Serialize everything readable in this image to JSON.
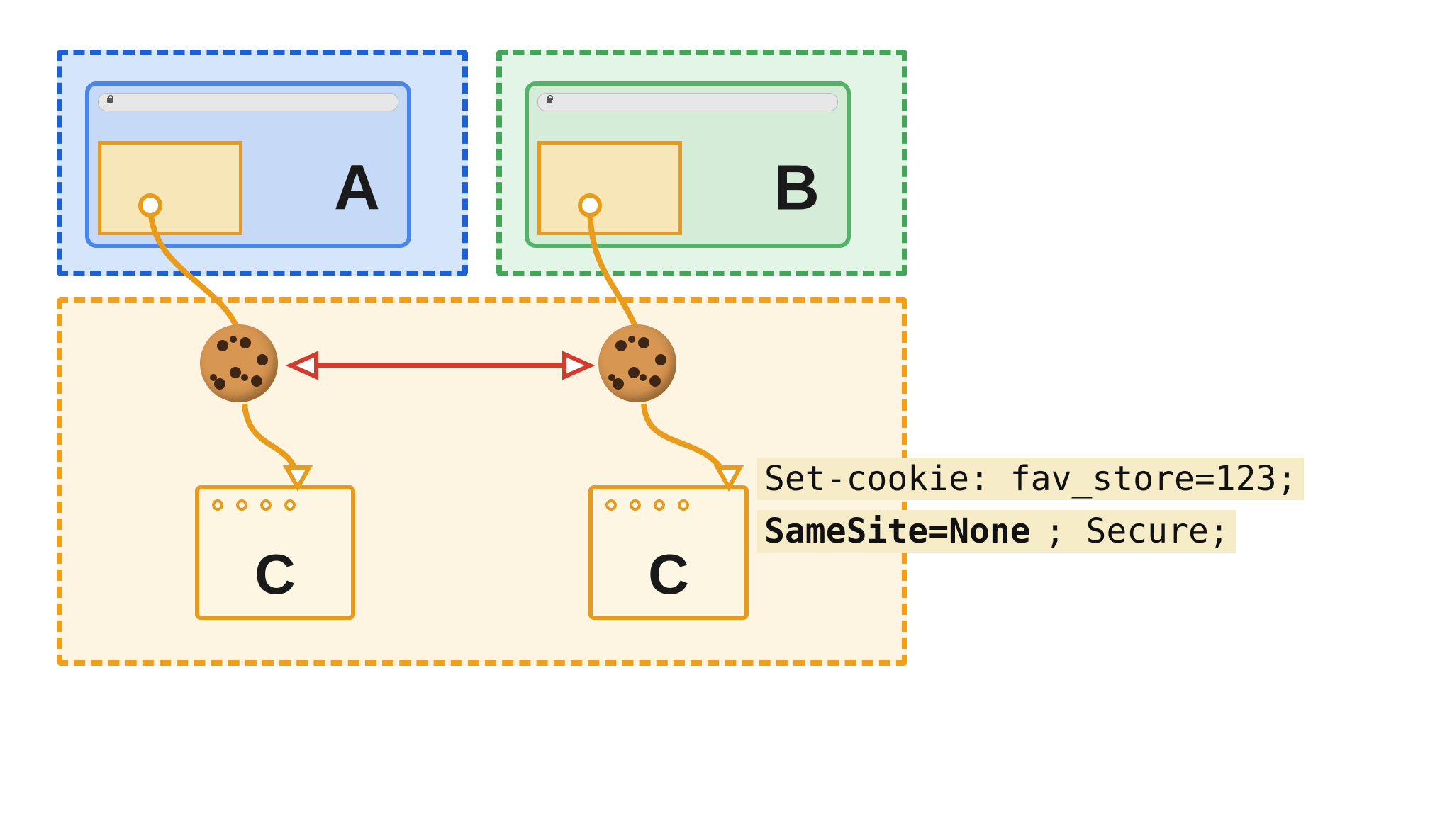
{
  "regions": {
    "blue": {
      "label": "A",
      "color": "#1f5fcf"
    },
    "green": {
      "label": "B",
      "color": "#46a35a"
    },
    "orange": {
      "label": "C",
      "color": "#ef9f1b"
    }
  },
  "browsers": {
    "blue": {
      "label": "A"
    },
    "green": {
      "label": "B"
    }
  },
  "c_windows": {
    "left": {
      "label": "C"
    },
    "right": {
      "label": "C"
    }
  },
  "cookies": [
    "cookie1",
    "cookie2"
  ],
  "code_callout": {
    "line1_full": "Set-cookie: fav_store=123;",
    "line2_bold": "SameSite=None",
    "line2_rest": "; Secure;"
  },
  "arrow": {
    "bidirectional": true,
    "between": [
      "cookie1",
      "cookie2"
    ],
    "color": "#d23b2e"
  }
}
